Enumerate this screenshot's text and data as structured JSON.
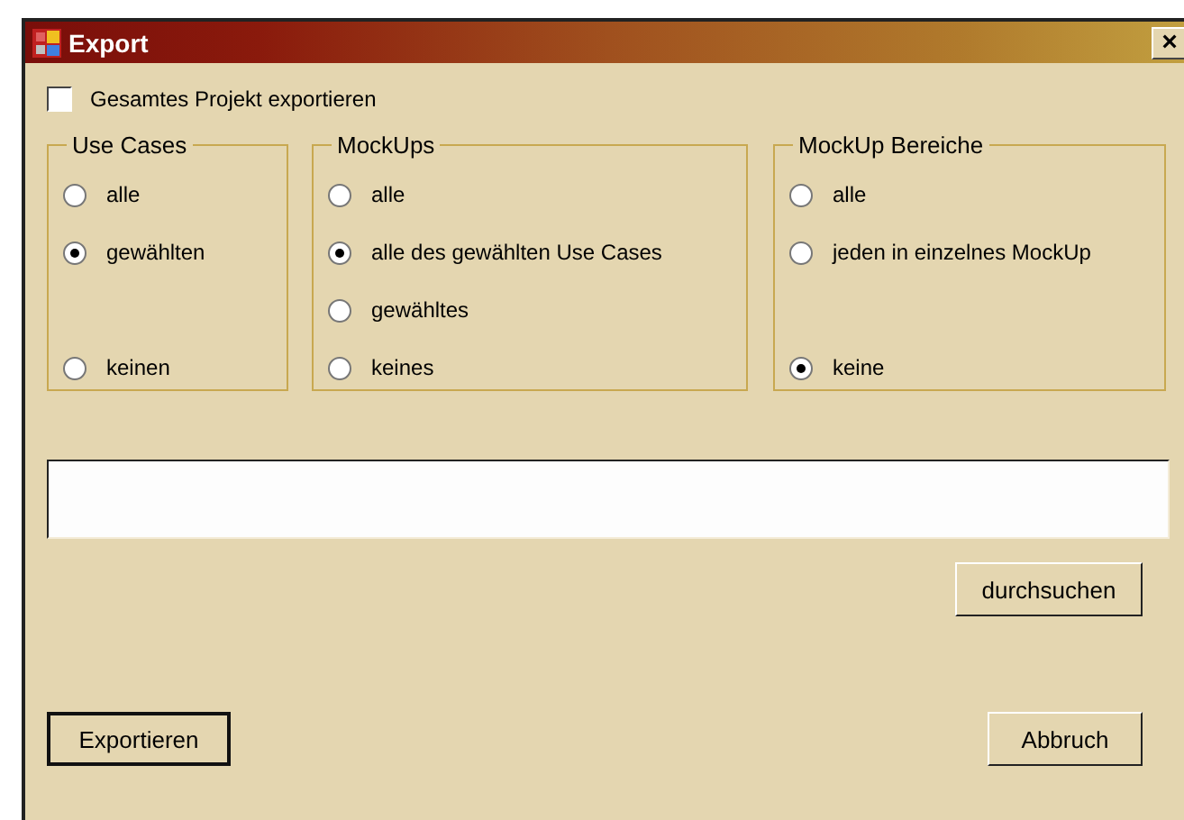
{
  "window": {
    "title": "Export",
    "close_label": "×"
  },
  "export_all": {
    "label": "Gesamtes Projekt exportieren",
    "checked": false
  },
  "groups": [
    {
      "title": "Use Cases",
      "options": [
        {
          "kind": "radio",
          "label": "alle",
          "selected": false
        },
        {
          "kind": "radio",
          "label": "gewählten",
          "selected": true
        },
        {
          "kind": "blank"
        },
        {
          "kind": "radio",
          "label": "keinen",
          "selected": false
        }
      ]
    },
    {
      "title": "MockUps",
      "options": [
        {
          "kind": "radio",
          "label": "alle",
          "selected": false
        },
        {
          "kind": "radio",
          "label": "alle des gewählten Use Cases",
          "selected": true
        },
        {
          "kind": "radio",
          "label": "gewähltes",
          "selected": false
        },
        {
          "kind": "radio",
          "label": "keines",
          "selected": false
        }
      ]
    },
    {
      "title": "MockUp Bereiche",
      "options": [
        {
          "kind": "radio",
          "label": "alle",
          "selected": false
        },
        {
          "kind": "radio",
          "label": "jeden in einzelnes MockUp",
          "selected": false
        },
        {
          "kind": "blank"
        },
        {
          "kind": "radio",
          "label": "keine",
          "selected": true
        }
      ]
    }
  ],
  "browse_button": "durchsuchen",
  "buttons": [
    "Exportieren",
    "Abbruch"
  ]
}
